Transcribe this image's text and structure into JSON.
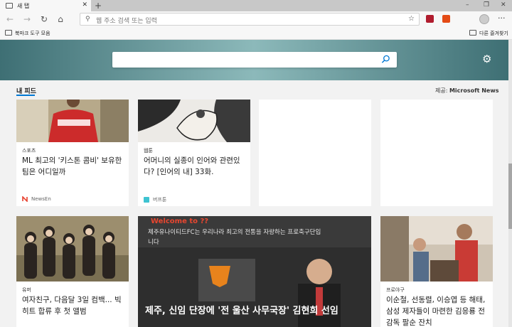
{
  "tab": {
    "title": "새 탭",
    "close": "✕",
    "new_tab": "+"
  },
  "window_controls": {
    "minimize": "–",
    "restore": "❐",
    "close": "✕"
  },
  "nav": {
    "back": "←",
    "forward": "→",
    "refresh": "↻",
    "home": "⌂"
  },
  "address": {
    "placeholder": "웹 주소 검색 또는 입력",
    "search_icon": "⚲",
    "favorite": "☆"
  },
  "menu": {
    "more": "···"
  },
  "favorites": {
    "left": "북마크 도구 모음",
    "right": "다른 즐겨찾기"
  },
  "search": {
    "placeholder": ""
  },
  "settings_icon": "⚙",
  "feed": {
    "tab_label": "내 피드",
    "provider_label": "제공:",
    "provider_name": "Microsoft News"
  },
  "cards": [
    {
      "category": "스포츠",
      "title": "ML 최고의 '키스톤 콤비' 보유한 팀은 어디일까",
      "source": "NewsEn",
      "source_color": "#e8412f"
    },
    {
      "category": "웹툰",
      "title": "어머니의 실종이 인어와 관련있다? [인어의 내] 33화.",
      "source": "버프툰",
      "source_color": "#3ec3d1"
    },
    {
      "category": "유머",
      "title": "여자친구, 다음달 3일 컴백... 빅히트 합류 후 첫 앨범"
    },
    {
      "title": "제주, 신임 단장에 '전 울산 사무국장' 김현희 선임",
      "image_caption": "제주유나이티드FC는 우리나라 최고의 전통을 자랑하는 프로축구단입니다",
      "image_sign": "Welcome to ??"
    },
    {
      "category": "프로야구",
      "title": "이순철, 선동렬, 이승엽 등 해태, 삼성 제자들이 마련한 김응룡 전 감독 팔순 잔치"
    }
  ],
  "colors": {
    "accent": "#0078d4",
    "hero_dark": "#3e6f74",
    "hero_light": "#8cb9ba"
  }
}
